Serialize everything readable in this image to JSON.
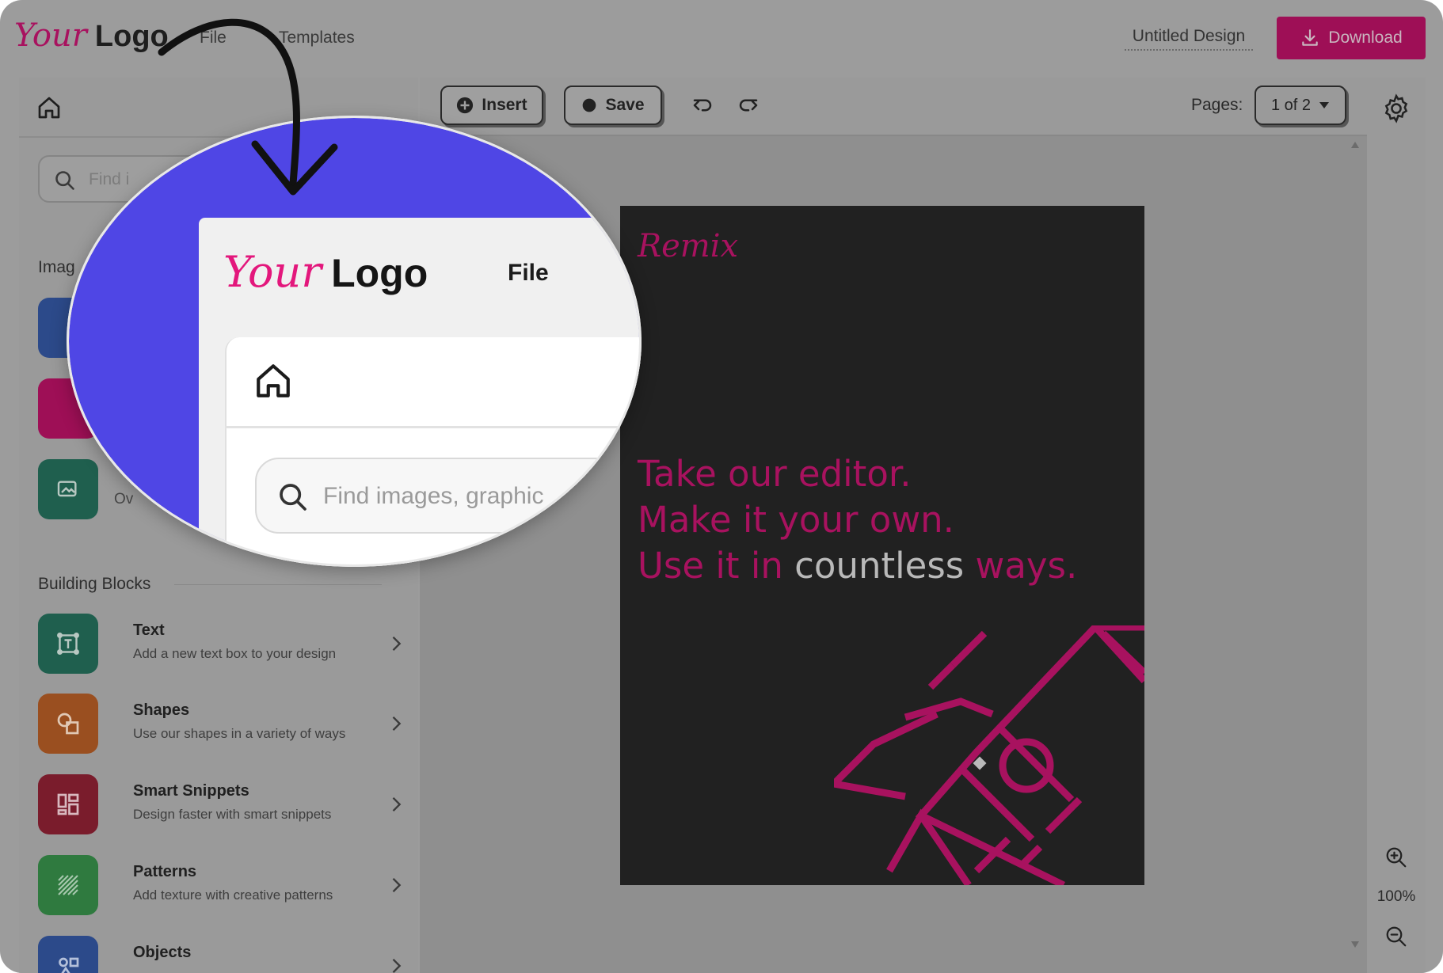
{
  "header": {
    "logo_your": "Your",
    "logo_word": "Logo",
    "menu": [
      "File",
      "Templates"
    ],
    "document_title": "Untitled Design",
    "download_label": "Download"
  },
  "sidebar": {
    "search_placeholder": "Find i",
    "images_section_title": "Imag",
    "overlay_stub_label": "Ov",
    "building_blocks_title": "Building Blocks",
    "blocks": [
      {
        "title": "Text",
        "description": "Add a new text box to your design",
        "icon": "text-frame-icon",
        "color": "#1f5f4e"
      },
      {
        "title": "Shapes",
        "description": "Use our shapes in a variety of ways",
        "icon": "shapes-icon",
        "color": "#9a4f20"
      },
      {
        "title": "Smart Snippets",
        "description": "Design faster with smart snippets",
        "icon": "snippets-icon",
        "color": "#7a1c2c"
      },
      {
        "title": "Patterns",
        "description": "Add texture with creative patterns",
        "icon": "pattern-icon",
        "color": "#2f7a3f"
      },
      {
        "title": "Objects",
        "description": "",
        "icon": "objects-icon",
        "color": "#2c4a8a"
      }
    ]
  },
  "toolbar": {
    "insert_label": "Insert",
    "save_label": "Save",
    "pages_label": "Pages:",
    "pages_value": "1 of 2"
  },
  "zoom": {
    "level": "100%"
  },
  "design": {
    "brand": "Remix",
    "line1": "Take our editor.",
    "line2": "Make it your own.",
    "line3_prefix": "Use it in",
    "line3_highlight": "countless",
    "line3_suffix": "ways."
  },
  "magnifier": {
    "logo_your": "Your",
    "logo_word": "Logo",
    "file_label": "File",
    "search_placeholder": "Find images, graphic"
  },
  "colors": {
    "brand_pink": "#e3177c",
    "overlay_purple": "#4f46e5",
    "design_bg": "#212121"
  }
}
